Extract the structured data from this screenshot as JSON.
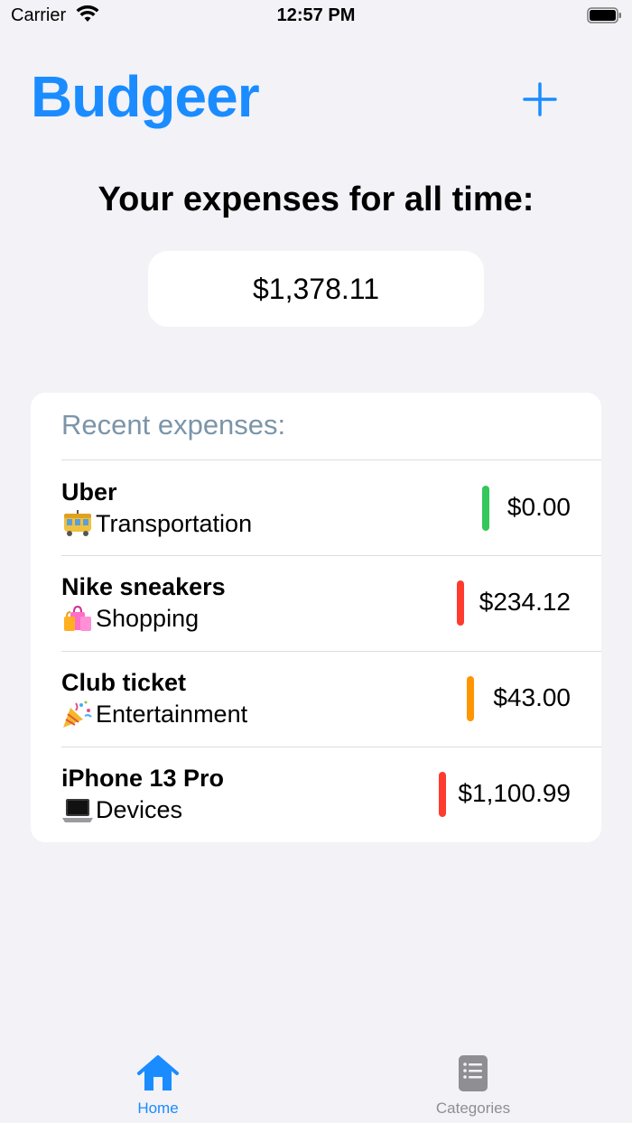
{
  "status": {
    "carrier": "Carrier",
    "time": "12:57 PM"
  },
  "header": {
    "title": "Budgeer",
    "add_icon": "plus-icon"
  },
  "summary": {
    "heading": "Your expenses for all time:",
    "total": "$1,378.11"
  },
  "recent": {
    "title": "Recent expenses:",
    "items": [
      {
        "name": "Uber",
        "category": "Transportation",
        "category_icon": "tram-icon",
        "amount": "$0.00",
        "indicator_color": "#34c759"
      },
      {
        "name": "Nike sneakers",
        "category": "Shopping",
        "category_icon": "shopping-bags-icon",
        "amount": "$234.12",
        "indicator_color": "#ff3b30"
      },
      {
        "name": "Club ticket",
        "category": "Entertainment",
        "category_icon": "party-popper-icon",
        "amount": "$43.00",
        "indicator_color": "#ff9500"
      },
      {
        "name": "iPhone 13 Pro",
        "category": "Devices",
        "category_icon": "laptop-icon",
        "amount": "$1,100.99",
        "indicator_color": "#ff3b30"
      }
    ]
  },
  "tabs": [
    {
      "label": "Home",
      "icon": "house-icon",
      "active": true
    },
    {
      "label": "Categories",
      "icon": "list-icon",
      "active": false
    }
  ],
  "colors": {
    "accent": "#1a8cff",
    "inactive": "#8e8e93"
  }
}
